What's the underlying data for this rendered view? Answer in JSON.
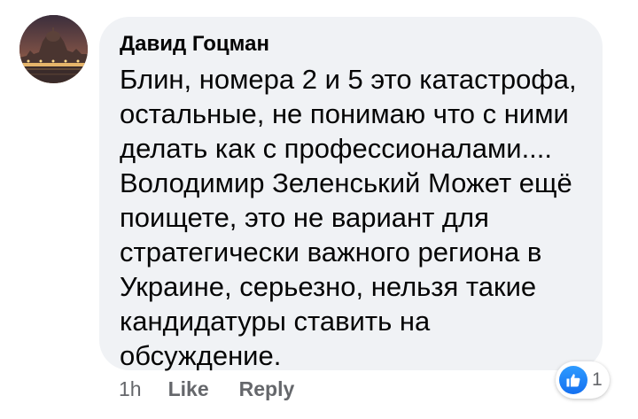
{
  "comment": {
    "author": "Давид Гоцман",
    "text": "Блин, номера 2 и 5 это катастрофа, остальные, не понимаю что с ними делать как с профессионалами.... Володимир Зеленський Может ещё поищете, это не вариант для стратегически важного региона в Украине, серьезно, нельзя такие кандидатуры ставить на обсуждение.",
    "time": "1h",
    "like_label": "Like",
    "reply_label": "Reply",
    "reaction_icon": "thumbs-up-icon",
    "reaction_count": "1"
  },
  "colors": {
    "bubble": "#f0f2f5",
    "text": "#050505",
    "secondary": "#65676b",
    "like_blue": "#1877f2"
  }
}
